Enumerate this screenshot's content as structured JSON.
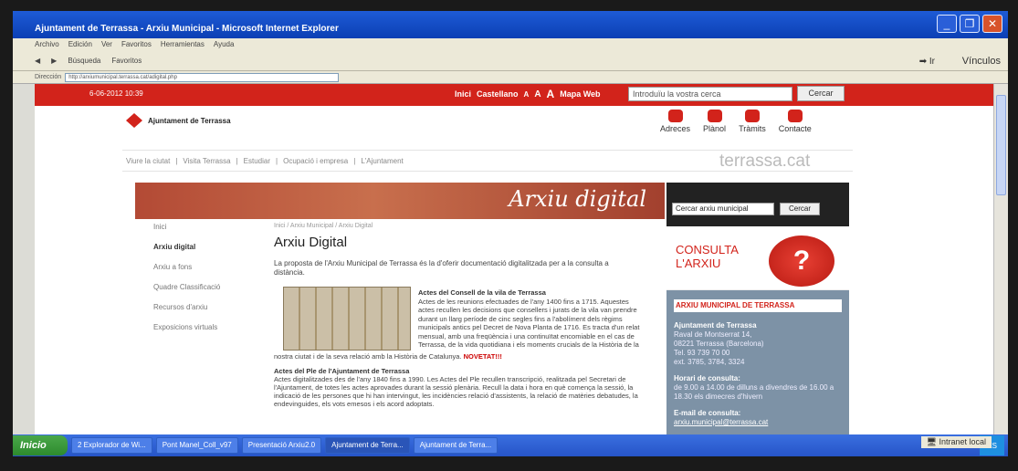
{
  "window": {
    "title": "Ajuntament de Terrassa - Arxiu Municipal - Microsoft Internet Explorer"
  },
  "menu": [
    "Archivo",
    "Edición",
    "Ver",
    "Favoritos",
    "Herramientas",
    "Ayuda"
  ],
  "toolbar": {
    "search_label": "Búsqueda",
    "favorites_label": "Favoritos",
    "go_label": "Ir",
    "links_label": "Vínculos"
  },
  "address": {
    "label": "Dirección",
    "url": "http://arxiumunicipal.terrassa.cat/adigital.php"
  },
  "site": {
    "date": "6-06-2012 10:39",
    "top_links": [
      "Inici",
      "Castellano",
      "A",
      "A",
      "A",
      "Mapa Web"
    ],
    "search_placeholder": "Introduïu la vostra cerca",
    "search_button": "Cercar",
    "logo_text": "Ajuntament de Terrassa",
    "shortcuts": [
      "Adreces",
      "Plànol",
      "Tràmits",
      "Contacte"
    ],
    "nav": [
      "Viure la ciutat",
      "Visita Terrassa",
      "Estudiar",
      "Ocupació i empresa",
      "L'Ajuntament"
    ],
    "brand": "terrassa.cat",
    "banner_title": "Arxiu digital",
    "sidebar": [
      "Inici",
      "Arxiu digital",
      "Arxiu a fons",
      "Quadre Classificació",
      "Recursos d'arxiu",
      "Exposicions virtuals"
    ],
    "breadcrumb": "Inici / Arxiu Municipal / Arxiu Digital",
    "page_title": "Arxiu Digital",
    "intro": "La proposta de l'Arxiu Municipal de Terrassa és la d'oferir documentació digitalitzada per a la consulta a distància.",
    "actes1_title": "Actes del Consell de la vila de Terrassa",
    "actes1_text": "Actes de les reunions efectuades de l'any 1400 fins a 1715. Aquestes actes recullen les decisions que consellers i jurats de la vila van prendre durant un llarg període de cinc segles fins a l'abolíment dels règims municipals antics pel Decret de Nova Planta de 1716. Es tracta d'un relat mensual, amb una freqüència i una continuïtat encomiable en el cas de Terrassa, de la vida quotidiana i els moments crucials de la Història de la",
    "actes1_tail": "nostra ciutat i de la seva relació amb la Història de Catalunya.",
    "novetat": "NOVETAT!!!",
    "actes2_title": "Actes del Ple de l'Ajuntament de Terrassa",
    "actes2_text": "Actes digitalitzades des de l'any 1840 fins a 1990. Les Actes del Ple recullen transcripció, realitzada pel Secretari de l'Ajuntament, de totes les actes aprovades durant la sessió plenària. Recull la data i hora en què comença la sessió, la indicació de les persones que hi han intervingut, les incidències relació d'assistents, la relació de matèries debatudes, la endevinguides, els vots emesos i els acord adoptats.",
    "right_search_placeholder": "Cercar arxiu municipal",
    "right_search_button": "Cercar",
    "consulta": [
      "CONSULTA",
      "L'ARXIU"
    ],
    "info_title": "ARXIU MUNICIPAL DE TERRASSA",
    "info_name": "Ajuntament de Terrassa",
    "info_address": [
      "Raval de Montserrat 14,",
      "08221 Terrassa (Barcelona)",
      "Tel. 93 739 70 00",
      "ext. 3785, 3784, 3324"
    ],
    "hours_title": "Horari de consulta:",
    "hours": "de 9.00 a 14.00 de dilluns a divendres de 16.00 a 18.30 els dimecres d'hivern",
    "email_title": "E-mail de consulta:",
    "email": "arxiu.municipal@terrassa.cat"
  },
  "taskbar": {
    "start": "Inicio",
    "tasks": [
      "2 Explorador de Wi...",
      "Pont Manel_Coll_v97",
      "Presentació Arxiu2.0",
      "Ajuntament de Terra...",
      "Ajuntament de Terra..."
    ],
    "lang": "ES",
    "zone": "Intranet local"
  }
}
